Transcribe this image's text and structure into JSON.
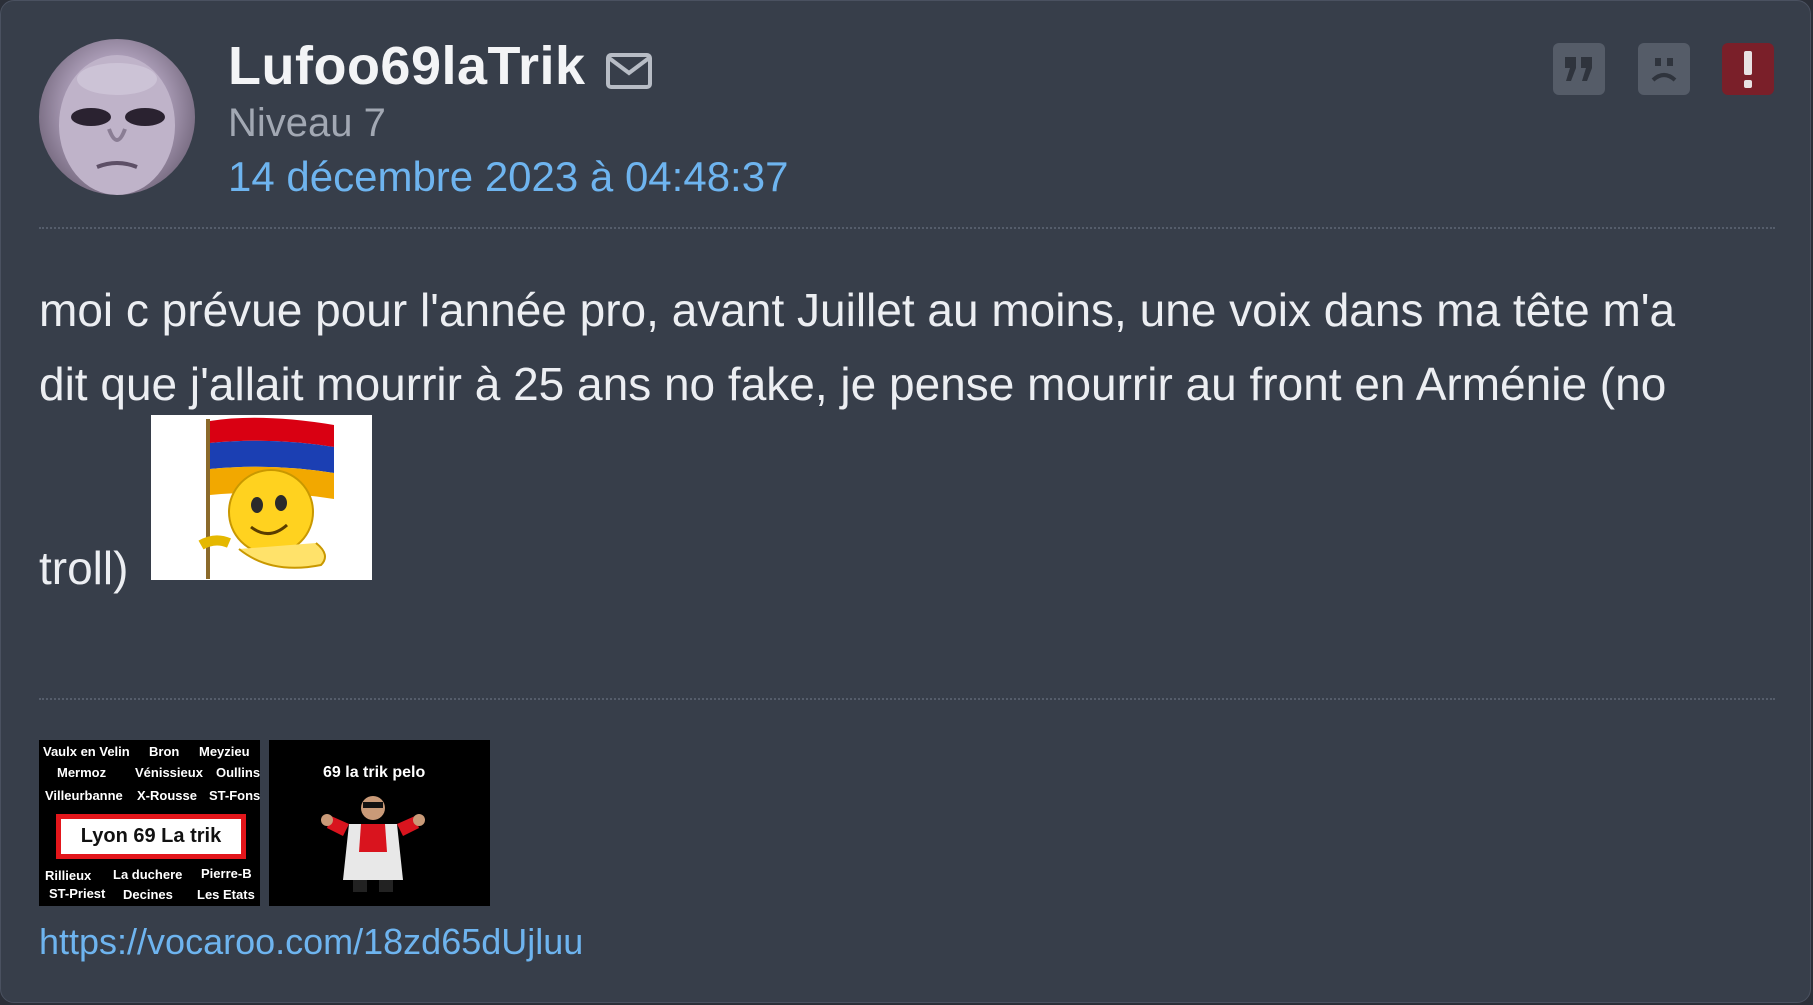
{
  "post": {
    "author": "Lufoo69laTrik",
    "level": "Niveau 7",
    "date": "14 décembre 2023 à 04:48:37",
    "message_line1": "moi c prévue pour l'année pro, avant Juillet au moins, une voix dans ma tête m'a",
    "message_line2": "dit que j'allait mourrir à 25 ans no fake, je pense mourrir au front en Arménie (no",
    "message_line3": "troll)",
    "icons": {
      "mail": "envelope-icon",
      "quote": "quote-icon",
      "sad": "sad-face-icon",
      "report": "exclamation-icon"
    },
    "colors": {
      "background": "#373e4a",
      "accent_link": "#6eb4ef",
      "report": "#7a1f29"
    }
  },
  "signature": {
    "image1": {
      "cities": [
        "Vaulx en Velin",
        "Bron",
        "Meyzieu",
        "Mermoz",
        "Vénissieux",
        "Oullins",
        "Villeurbanne",
        "X-Rousse",
        "ST-Fons",
        "Rillieux",
        "La duchere",
        "Pierre-B",
        "ST-Priest",
        "Decines",
        "Les Etats"
      ],
      "title": "Lyon 69 La trik"
    },
    "image2": {
      "caption": "69 la trik pelo"
    },
    "link": "https://vocaroo.com/18zd65dUjluu"
  }
}
